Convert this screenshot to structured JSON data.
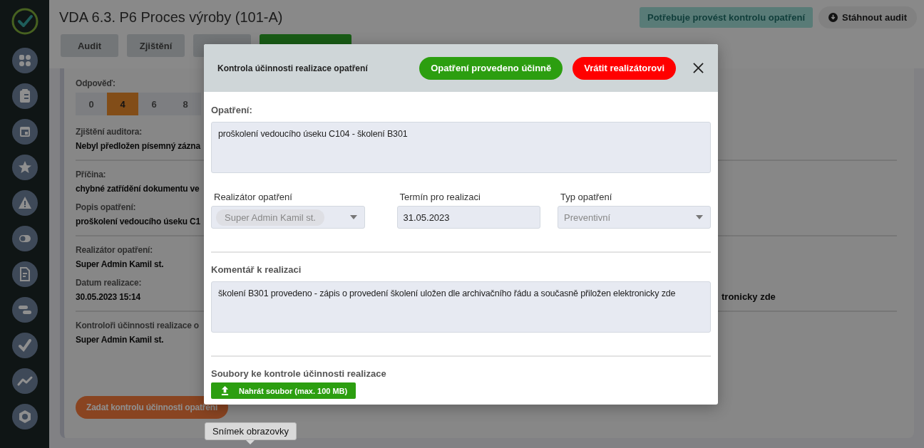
{
  "page": {
    "title": "VDA 6.3. P6 Proces výroby (101-A)",
    "status_badge": "Potřebuje provést kontrolu opatření",
    "download_button": "Stáhnout audit",
    "tabs": [
      {
        "label": "Audit",
        "selected": false
      },
      {
        "label": "Zjištění",
        "selected": false
      },
      {
        "selected": false
      },
      {
        "selected": true
      }
    ]
  },
  "answer": {
    "label": "Odpověď:",
    "options": [
      {
        "label": "0",
        "selected": false
      },
      {
        "label": "4",
        "selected": true
      },
      {
        "label": "6",
        "selected": false
      },
      {
        "label": "8",
        "selected": false
      }
    ]
  },
  "sections": [
    {
      "fields": [
        {
          "label": "Zjištění auditora:",
          "value": "Nebyl předložen písemný zázna"
        }
      ]
    },
    {
      "fields": [
        {
          "label": "Příčina:",
          "value": "chybné zatřídění dokumentu ve"
        },
        {
          "label": "Popis opatření:",
          "value": "proškolení vedoucího úseku C1"
        }
      ]
    },
    {
      "fields": [
        {
          "label": "Realizátor opatření:",
          "value": "Super Admin Kamil st."
        },
        {
          "label": "Datum realizace:",
          "value": "30.05.2023 15:14"
        }
      ],
      "side_text": "tronicky zde"
    },
    {
      "fields": [
        {
          "label": "Kontroloři účinnosti realizace o",
          "value": "Super Admin Kamil st."
        }
      ]
    }
  ],
  "action_button": "Zadat kontrolu účinnosti opatření",
  "tooltip": "Snímek obrazovky",
  "modal": {
    "title": "Kontrola účinnosti realizace opatření",
    "buttons": [
      {
        "label": "Opatření provedeno účinně",
        "kind": "confirm"
      },
      {
        "label": "Vrátit realizátorovi",
        "kind": "reject"
      }
    ],
    "measure": {
      "label": "Opatření:",
      "value": "proškolení vedoucího úseku C104 - školení B301"
    },
    "fields": [
      {
        "label": "Realizátor opatření",
        "kind": "tag-select",
        "value": "Super Admin Kamil st.",
        "disabled": true
      },
      {
        "label": "Termín pro realizaci",
        "kind": "input",
        "value": "31.05.2023",
        "disabled": false
      },
      {
        "label": "Typ opatření",
        "kind": "select",
        "value": "Preventivní",
        "disabled": true
      }
    ],
    "comment": {
      "label": "Komentář k realizaci",
      "value": "školení B301 provedeno - zápis o provedení školení uložen dle archivačního řádu a současně přiložen elektronicky zde"
    },
    "files": {
      "label": "Soubory ke kontrole účinnosti realizace",
      "upload_button": "Nahrát soubor (max. 100 MB)"
    }
  }
}
